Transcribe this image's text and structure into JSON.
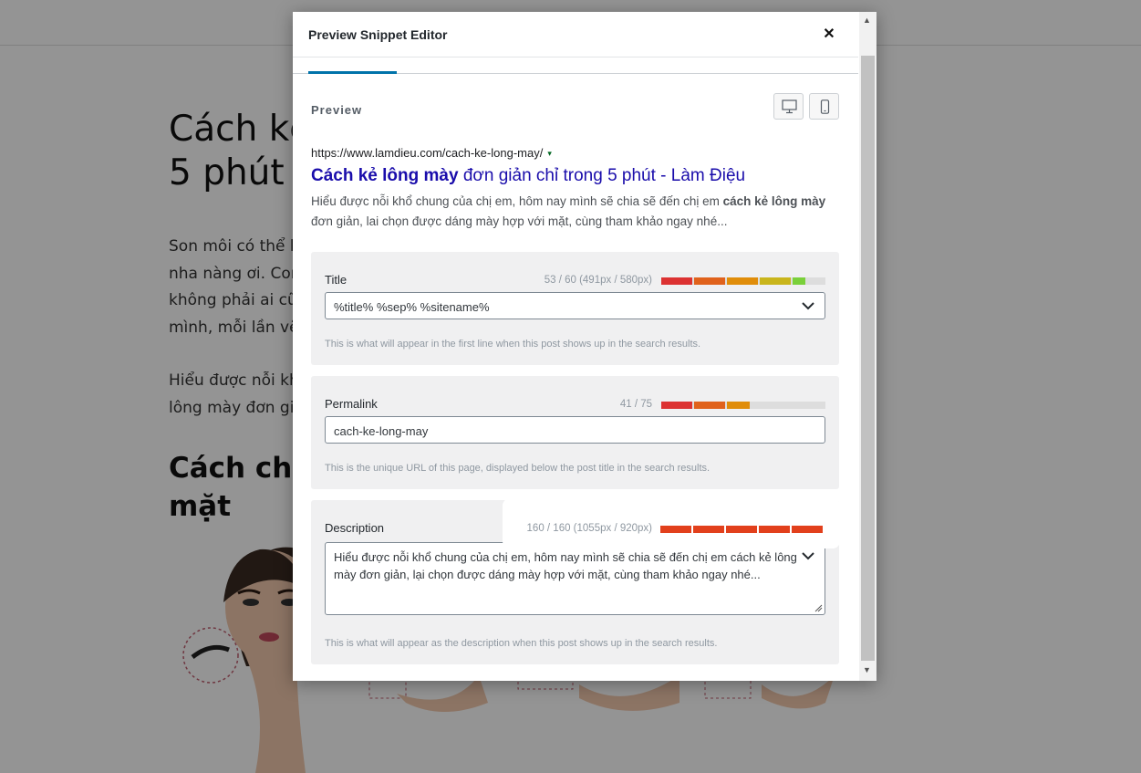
{
  "article": {
    "h1_line1": "Cách kẻ",
    "h1_line2": "5 phút",
    "p1_lines": [
      "Son môi có thể k",
      "nha nàng ơi. Cor",
      "không phải ai cũ",
      "mình, mỗi lần vẽ"
    ],
    "p2_lines": [
      "Hiểu được nỗi kh",
      "lông mày đơn gi"
    ],
    "h2_line1": "Cách chọ",
    "h2_line2": "mặt"
  },
  "modal": {
    "title": "Preview Snippet Editor",
    "close_icon": "close-icon",
    "preview_label": "Preview",
    "desktop_icon": "desktop-icon",
    "mobile_icon": "mobile-icon",
    "serp": {
      "url": "https://www.lamdieu.com/cach-ke-long-may/",
      "caret": "▾",
      "title_bold": "Cách kẻ lông mày",
      "title_rest": " đơn giản chỉ trong 5 phút - Làm Điệu",
      "desc_part1": "Hiểu được nỗi khổ chung của chị em, hôm nay mình sẽ chia sẽ đến chị em ",
      "desc_bold": "cách kẻ lông mày",
      "desc_part2": " đơn giản, lai chọn được dáng mày hợp với mặt, cùng tham khảo ngay nhé..."
    },
    "title_field": {
      "label": "Title",
      "counter": "53 / 60 (491px / 580px)",
      "value": "%title% %sep% %sitename%",
      "help": "This is what will appear in the first line when this post shows up in the search results.",
      "meter_fill": 0.88
    },
    "permalink_field": {
      "label": "Permalink",
      "counter": "41 / 75",
      "value": "cach-ke-long-may",
      "help": "This is the unique URL of this page, displayed below the post title in the search results.",
      "meter_fill": 0.54
    },
    "description_field": {
      "label": "Description",
      "counter": "160 / 160 (1055px / 920px)",
      "value": "Hiểu được nỗi khổ chung của chị em, hôm nay mình sẽ chia sẽ đến chị em cách kẻ lông mày đơn giản, lại chọn được dáng mày hợp với mặt, cùng tham khảo ngay nhé...",
      "help": "This is what will appear as the description when this post shows up in the search results.",
      "meter_fill": 1.0
    }
  },
  "colors": {
    "link": "#1a0dab",
    "accent": "#0073aa",
    "meter_red": "#e2401c",
    "meter_orange": "#e08d0a",
    "meter_green": "#7ad03a"
  }
}
